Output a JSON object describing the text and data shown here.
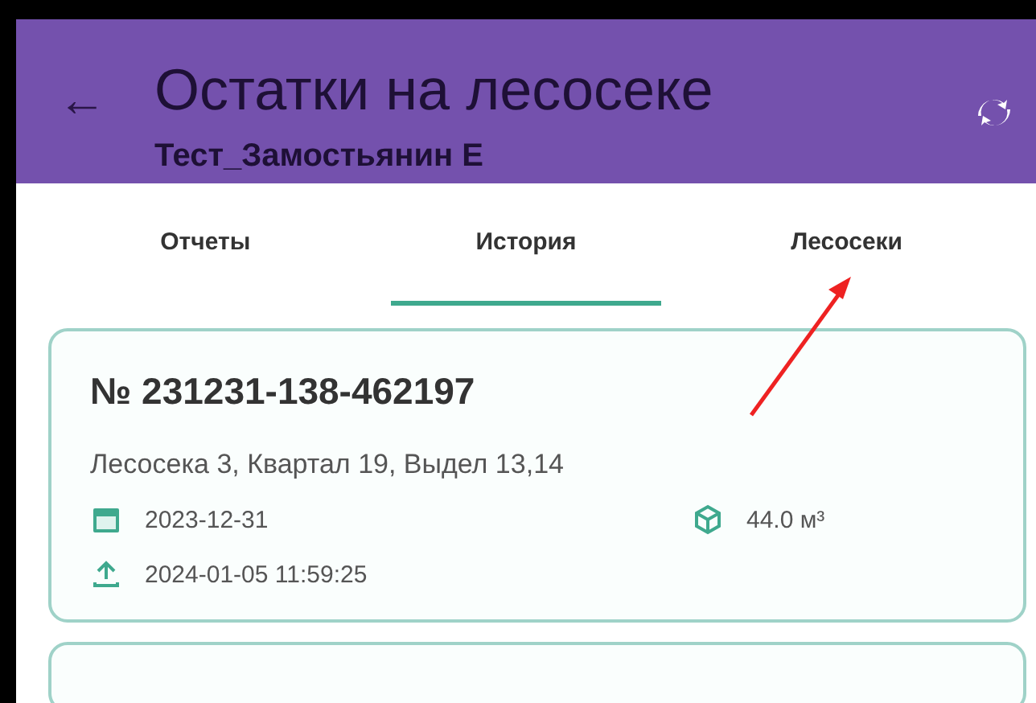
{
  "header": {
    "back": "←",
    "title": "Остатки на лесосеке",
    "subtitle": "Тест_Замостьянин Е"
  },
  "tabs": [
    {
      "label": "Отчеты",
      "selected": false
    },
    {
      "label": "История",
      "selected": true
    },
    {
      "label": "Лесосеки",
      "selected": false
    }
  ],
  "cards": [
    {
      "number": "№ 231231-138-462197",
      "place": "Лесосека 3, Квартал 19, Выдел 13,14",
      "date": "2023-12-31",
      "volume": "44.0 м³",
      "uploaded": "2024-01-05 11:59:25"
    }
  ]
}
